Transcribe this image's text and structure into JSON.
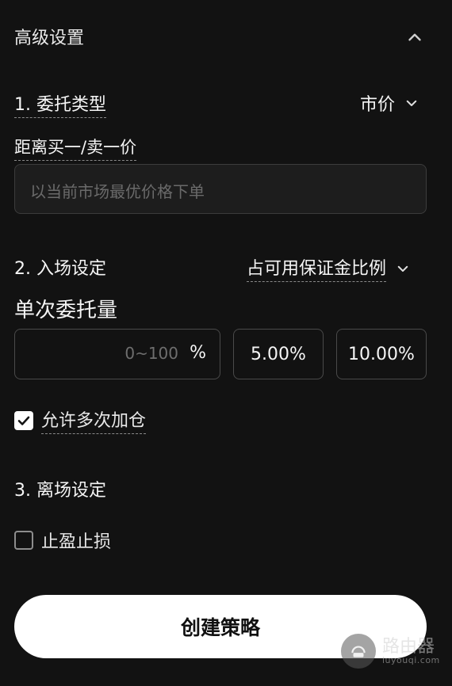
{
  "header": {
    "title": "高级设置"
  },
  "section1": {
    "label": "1. 委托类型",
    "select_value": "市价",
    "field_label": "距离买一/卖一价",
    "input_placeholder": "以当前市场最优价格下单"
  },
  "section2": {
    "label": "2. 入场设定",
    "select_value": "占可用保证金比例",
    "amount_label": "单次委托量",
    "amount_placeholder": "0~100",
    "amount_unit": "%",
    "options": [
      "5.00%",
      "10.00%"
    ],
    "add_position_label": "允许多次加仓",
    "add_position_checked": true
  },
  "section3": {
    "label": "3. 离场设定",
    "tpsl_label": "止盈止损",
    "tpsl_checked": false
  },
  "create_button": "创建策略",
  "watermark": {
    "cn": "路由器",
    "en": "luyouqi.com"
  }
}
